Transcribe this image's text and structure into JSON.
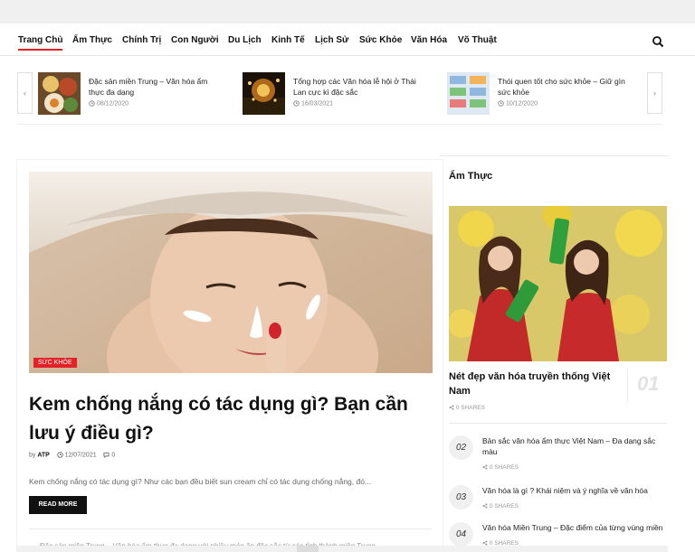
{
  "nav": {
    "items": [
      {
        "label": "Trang Chủ",
        "active": true
      },
      {
        "label": "Ẩm Thực"
      },
      {
        "label": "Chính Trị"
      },
      {
        "label": "Con Người"
      },
      {
        "label": "Du Lịch"
      },
      {
        "label": "Kinh Tế"
      },
      {
        "label": "Lịch Sử"
      },
      {
        "label": "Sức Khỏe"
      },
      {
        "label": "Văn Hóa"
      },
      {
        "label": "Võ Thuật"
      }
    ]
  },
  "ticker": {
    "prev": "‹",
    "next": "›",
    "items": [
      {
        "title": "Đặc sản miền Trung – Văn hóa ẩm thực đa dạng",
        "date": "08/12/2020"
      },
      {
        "title": "Tổng hợp các Văn hóa lễ hội ở Thái Lan cực kì đặc sắc",
        "date": "16/03/2021"
      },
      {
        "title": "Thói quen tốt cho sức khỏe – Giữ gìn sức khỏe",
        "date": "10/12/2020"
      }
    ]
  },
  "main_post": {
    "category": "SỨC KHỎE",
    "title": "Kem chống nắng có tác dụng gì? Bạn cần lưu ý điều gì?",
    "by": "by",
    "author": "ATP",
    "date": "12/07/2021",
    "comments": "0",
    "excerpt": "Kem chống nắng có tác dụng gì? Như các bạn đều biết sun cream chỉ có tác dụng chống nắng, đó...",
    "read_more": "READ MORE",
    "next_cut": "Đặc sản miền Trung – Văn hóa ẩm thực đa dạng với nhiều món ăn đặc sắc từ các tỉnh thành miền Trung..."
  },
  "sidebar": {
    "heading": "Ẩm Thực",
    "featured": {
      "title": "Nét đẹp văn hóa truyền thống Việt Nam",
      "number": "01",
      "shares": "0 SHARES"
    },
    "items": [
      {
        "number": "02",
        "title": "Bản sắc văn hóa ẩm thực Việt Nam – Đa dạng sắc màu",
        "shares": "0 SHARES"
      },
      {
        "number": "03",
        "title": "Văn hóa là gì ? Khái niệm và ý nghĩa về văn hóa",
        "shares": "0 SHARES"
      },
      {
        "number": "04",
        "title": "Văn hóa Miền Trung – Đặc điểm của từng vùng miền",
        "shares": "0 SHARES"
      }
    ]
  },
  "colors": {
    "accent": "#e32227",
    "button": "#111111"
  }
}
